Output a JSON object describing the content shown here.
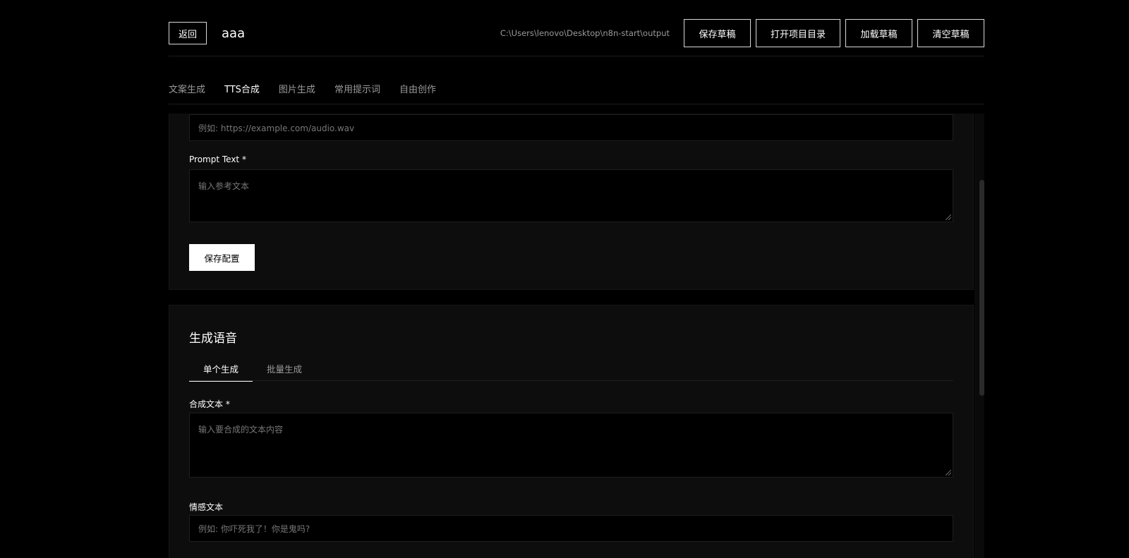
{
  "header": {
    "back_label": "返回",
    "project_name": "aaa",
    "path": "C:\\Users\\lenovo\\Desktop\\n8n-start\\output",
    "buttons": {
      "save_draft": "保存草稿",
      "open_project_dir": "打开项目目录",
      "load_draft": "加载草稿",
      "clear_draft": "清空草稿"
    }
  },
  "main_tabs": [
    {
      "label": "文案生成",
      "active": false
    },
    {
      "label": "TTS合成",
      "active": true
    },
    {
      "label": "图片生成",
      "active": false
    },
    {
      "label": "常用提示词",
      "active": false
    },
    {
      "label": "自由创作",
      "active": false
    }
  ],
  "config_card": {
    "audio_url": {
      "value": "",
      "placeholder": "例如: https://example.com/audio.wav"
    },
    "prompt_text": {
      "label": "Prompt Text *",
      "value": "",
      "placeholder": "输入参考文本"
    },
    "save_config_label": "保存配置"
  },
  "generate_card": {
    "title": "生成语音",
    "sub_tabs": [
      {
        "label": "单个生成",
        "active": true
      },
      {
        "label": "批量生成",
        "active": false
      }
    ],
    "synth_text": {
      "label": "合成文本 *",
      "value": "",
      "placeholder": "输入要合成的文本内容"
    },
    "emotion_text": {
      "label": "情感文本",
      "value": "",
      "placeholder": "例如: 你吓死我了！你是鬼吗?"
    }
  },
  "colors": {
    "background": "#000000",
    "card": "#0d0d0d",
    "text": "#ffffff",
    "muted": "#9a9a9a",
    "primary_button": "#ffffff"
  }
}
